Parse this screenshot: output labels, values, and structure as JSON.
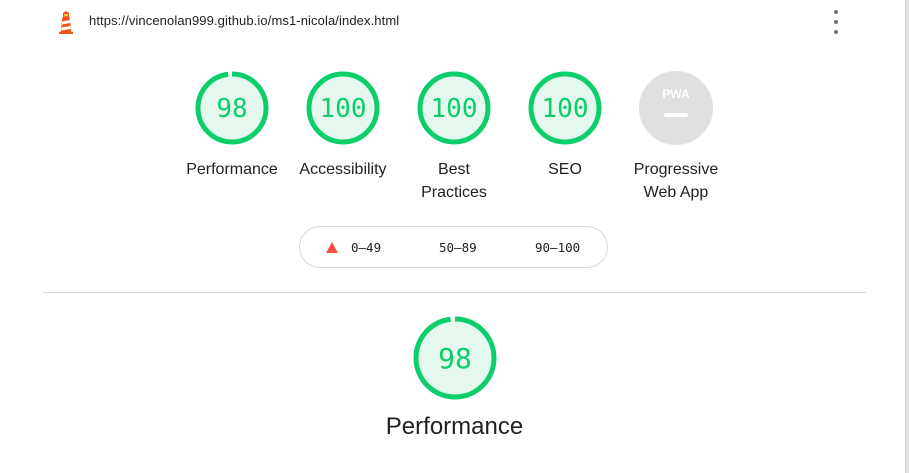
{
  "url": "https://vincenolan999.github.io/ms1-nicola/index.html",
  "icons": {
    "logo": "lighthouse-icon",
    "menu": "more-vert-icon",
    "pwa": "pwa-badge-icon",
    "fail": "triangle-fail-icon"
  },
  "colors": {
    "pass": "#0cce6b",
    "pass_bg": "#e5f8ee",
    "fail": "#ff4e42",
    "na": "#e0e0e0",
    "lighthouse": "#f4511e"
  },
  "gauges": [
    {
      "score": "98",
      "score_fraction": 0.98,
      "label": "Performance"
    },
    {
      "score": "100",
      "score_fraction": 1.0,
      "label": "Accessibility"
    },
    {
      "score": "100",
      "score_fraction": 1.0,
      "label_line1": "Best",
      "label_line2": "Practices"
    },
    {
      "score": "100",
      "score_fraction": 1.0,
      "label": "SEO"
    },
    {
      "badge_text": "PWA",
      "label_line1": "Progressive",
      "label_line2": "Web App"
    }
  ],
  "legend": {
    "fail": "0–49",
    "average": "50–89",
    "pass": "90–100"
  },
  "section": {
    "score": "98",
    "score_fraction": 0.98,
    "title": "Performance"
  }
}
